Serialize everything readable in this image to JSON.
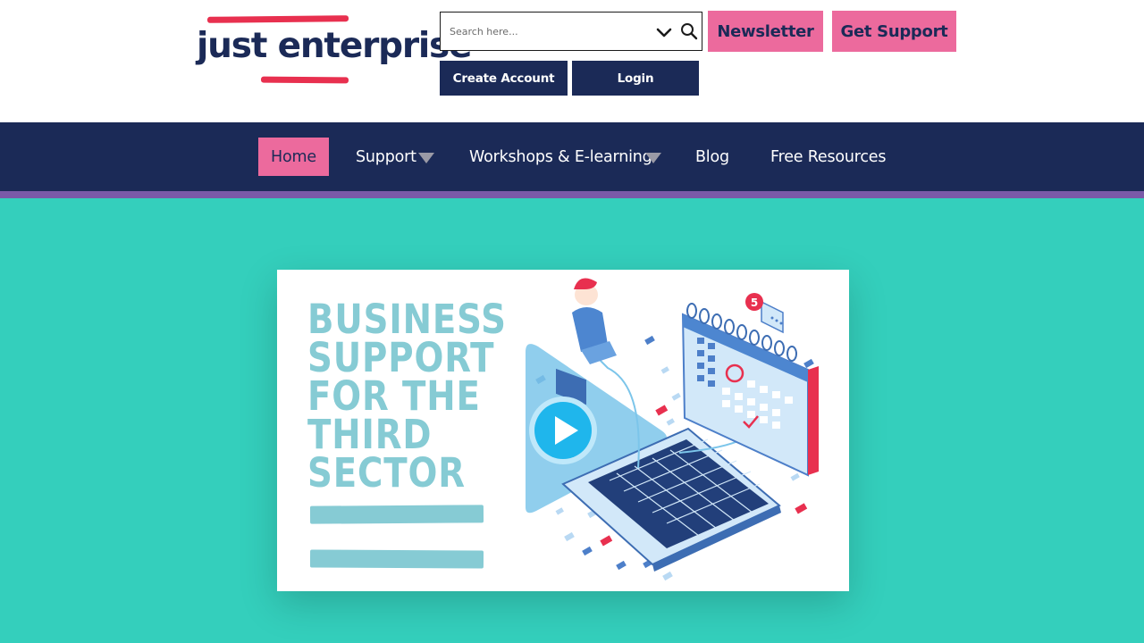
{
  "header": {
    "logo_text": "just enterprise",
    "search": {
      "placeholder": "Search here..."
    },
    "newsletter_label": "Newsletter",
    "get_support_label": "Get Support",
    "create_account_label": "Create Account",
    "login_label": "Login"
  },
  "nav": {
    "items": [
      {
        "label": "Home",
        "active": true
      },
      {
        "label": "Support",
        "has_dropdown": true
      },
      {
        "label": "Workshops & E-learning",
        "has_dropdown": true
      },
      {
        "label": "Blog"
      },
      {
        "label": "Free Resources"
      }
    ]
  },
  "hero": {
    "headline_lines": [
      "BUSINESS",
      "SUPPORT",
      "FOR THE",
      "THIRD",
      "SECTOR"
    ],
    "calendar_badge": "5",
    "play_icon": "play-icon"
  },
  "colors": {
    "navy": "#1b2a57",
    "pink": "#ec6a9d",
    "red": "#e8304f",
    "teal_bg": "#34cfbc",
    "stripe": "#7a5aa8",
    "headline": "#86cbd4",
    "play_blue": "#1fb6ec"
  }
}
